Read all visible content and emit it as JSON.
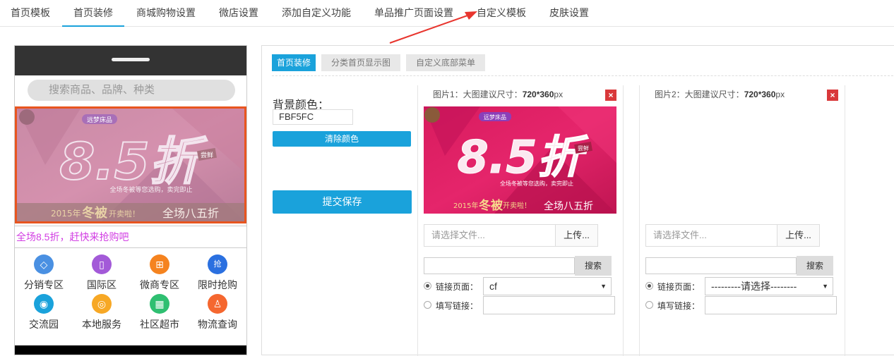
{
  "top_nav": {
    "tabs": [
      {
        "label": "首页模板"
      },
      {
        "label": "首页装修"
      },
      {
        "label": "商城购物设置"
      },
      {
        "label": "微店设置"
      },
      {
        "label": "添加自定义功能"
      },
      {
        "label": "单品推广页面设置"
      },
      {
        "label": "自定义模板"
      },
      {
        "label": "皮肤设置"
      }
    ],
    "active_index": 1
  },
  "phone_preview": {
    "search_placeholder": "搜索商品、品牌、种类",
    "banner": {
      "tag": "远梦床品",
      "side_text": "好被冬季暖暖",
      "big": "8.5折",
      "badge": "尝鲜",
      "sub": "全场冬被等您选购，卖完即止",
      "bottom_left": "2015年",
      "bottom_mid": "冬被",
      "bottom_mid2": "开卖啦！",
      "bottom_right": "全场八五折"
    },
    "tagline": "全场8.5折，赶快来抢购吧",
    "grid": [
      {
        "label": "分销专区",
        "icon": "diamond-icon",
        "color": "#4a90e2",
        "glyph": "◇"
      },
      {
        "label": "国际区",
        "icon": "bag-icon",
        "color": "#a35ad8",
        "glyph": "▯"
      },
      {
        "label": "微商专区",
        "icon": "gift-icon",
        "color": "#f5831f",
        "glyph": "⊞"
      },
      {
        "label": "限时抢购",
        "icon": "grab-icon",
        "color": "#2b70e0",
        "glyph": "抢"
      },
      {
        "label": "交流园",
        "icon": "chat-icon",
        "color": "#1aa2db",
        "glyph": "◉"
      },
      {
        "label": "本地服务",
        "icon": "location-icon",
        "color": "#f7a825",
        "glyph": "◎"
      },
      {
        "label": "社区超市",
        "icon": "store-icon",
        "color": "#2fbf71",
        "glyph": "▦"
      },
      {
        "label": "物流查询",
        "icon": "courier-icon",
        "color": "#f5672f",
        "glyph": "♙"
      }
    ]
  },
  "panel": {
    "subtabs": [
      {
        "label": "首页装修"
      },
      {
        "label": "分类首页显示图"
      },
      {
        "label": "自定义底部菜单"
      }
    ],
    "bg_color_label": "背景颜色：",
    "bg_color_value": "FBF5FC",
    "clear_color_button": "清除颜色",
    "save_button": "提交保存",
    "image_slots": [
      {
        "caption_prefix": "图片1：大图建议尺寸：",
        "caption_size": "720*360",
        "caption_unit": "px",
        "close": "×",
        "has_image": true,
        "file_placeholder": "请选择文件...",
        "upload_label": "上传...",
        "search_label": "搜索",
        "link_page_label": "链接页面：",
        "link_page_value": "cf",
        "custom_link_label": "填写链接："
      },
      {
        "caption_prefix": "图片2：大图建议尺寸：",
        "caption_size": "720*360",
        "caption_unit": "px",
        "close": "×",
        "has_image": false,
        "file_placeholder": "请选择文件...",
        "upload_label": "上传...",
        "search_label": "搜索",
        "link_page_label": "链接页面：",
        "link_page_value": "---------请选择--------",
        "custom_link_label": "填写链接："
      }
    ]
  },
  "colors": {
    "accent": "#1aa2db",
    "close_red": "#d9383a",
    "annotation_red": "#e8352e",
    "banner_pink": "#e0185a",
    "tagline_pink": "#d23ee3"
  }
}
